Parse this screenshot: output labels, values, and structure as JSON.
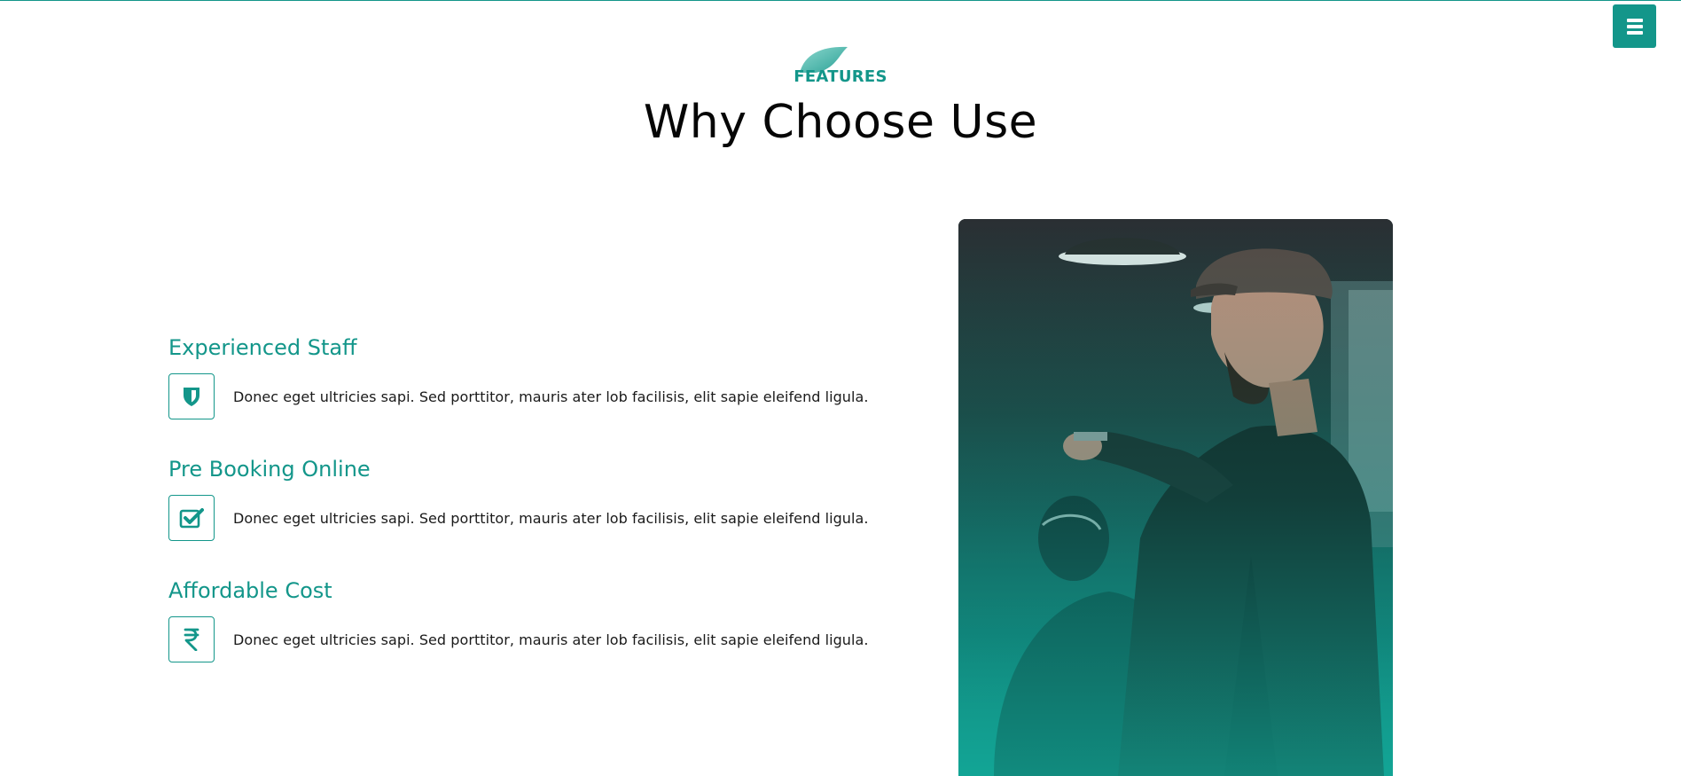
{
  "menu": {
    "icon": "hamburger-icon"
  },
  "section": {
    "eyebrow": "FEATURES",
    "title": "Why Choose Use"
  },
  "features": [
    {
      "title": "Experienced Staff",
      "icon": "shield-icon",
      "text": "Donec eget ultricies sapi. Sed porttitor, mauris ater lob facilisis, elit sapie eleifend ligula."
    },
    {
      "title": "Pre Booking Online",
      "icon": "checkbox-icon",
      "text": "Donec eget ultricies sapi. Sed porttitor, mauris ater lob facilisis, elit sapie eleifend ligula."
    },
    {
      "title": "Affordable Cost",
      "icon": "rupee-icon",
      "text": "Donec eget ultricies sapi. Sed porttitor, mauris ater lob facilisis, elit sapie eleifend ligula."
    }
  ],
  "colors": {
    "accent": "#13968a",
    "heading": "#060606",
    "text": "#1a1a1a"
  }
}
